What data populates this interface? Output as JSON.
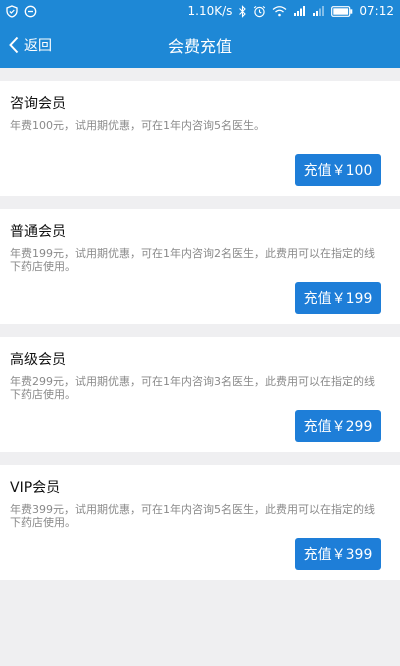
{
  "statusbar": {
    "network_speed": "1.10K/s",
    "time": "07:12"
  },
  "header": {
    "back_label": "返回",
    "title": "会费充值"
  },
  "plans": [
    {
      "name": "咨询会员",
      "description": "年费100元，试用期优惠，可在1年内咨询5名医生。",
      "button_label": "充值￥100"
    },
    {
      "name": "普通会员",
      "description": "年费199元，试用期优惠，可在1年内咨询2名医生，此费用可以在指定的线下药店使用。",
      "button_label": "充值￥199"
    },
    {
      "name": "高级会员",
      "description": "年费299元，试用期优惠，可在1年内咨询3名医生，此费用可以在指定的线下药店使用。",
      "button_label": "充值￥299"
    },
    {
      "name": "VIP会员",
      "description": "年费399元，试用期优惠，可在1年内咨询5名医生，此费用可以在指定的线下药店使用。",
      "button_label": "充值￥399"
    }
  ],
  "colors": {
    "primary": "#1e88d6",
    "button": "#1e7ed8",
    "background": "#efeff1"
  },
  "icons": {
    "status_left": [
      "shield-icon",
      "chat-icon"
    ],
    "status_right": [
      "bluetooth-icon",
      "alarm-icon",
      "wifi-icon",
      "signal-icon",
      "signal-icon",
      "battery-icon"
    ],
    "back": "chevron-left-icon"
  }
}
